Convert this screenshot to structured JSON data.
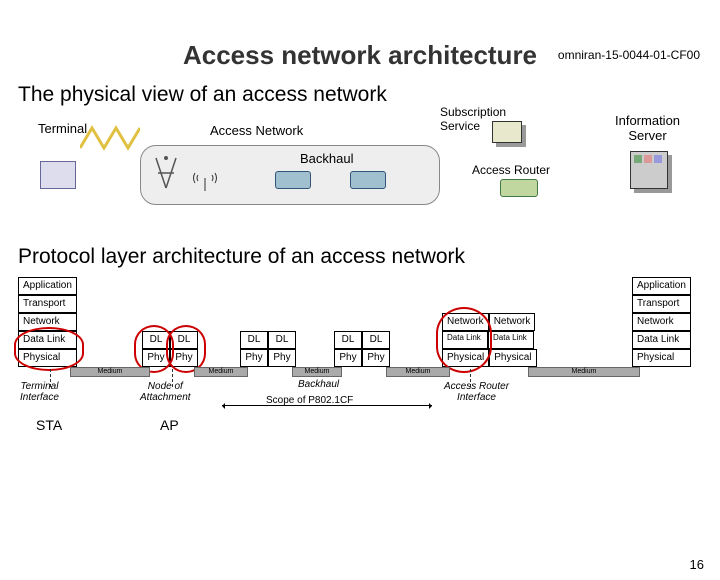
{
  "doc_id": "omniran-15-0044-01-CF00",
  "title": "Access network architecture",
  "subtitle1": "The physical view of an access network",
  "subtitle2": "Protocol layer architecture of an access network",
  "phys": {
    "terminal": "Terminal",
    "access_network": "Access Network",
    "backhaul": "Backhaul",
    "subscription_service": "Subscription\nService",
    "access_router": "Access Router",
    "information_server": "Information\nServer"
  },
  "proto": {
    "layers_left": [
      "Application",
      "Transport",
      "Network",
      "Data Link",
      "Physical"
    ],
    "layers_right": [
      "Application",
      "Transport",
      "Network",
      "Data Link",
      "Physical"
    ],
    "mid_top": [
      "Network",
      "Network"
    ],
    "mid_dl": [
      "Data Link",
      "Data Link"
    ],
    "mid_phy": [
      "Physical",
      "Physical"
    ],
    "dl": "DL",
    "phy": "Phy",
    "medium": "Medium",
    "terminal_if": "Terminal\nInterface",
    "node_of_attachment": "Node of\nAttachment",
    "backhaul": "Backhaul",
    "ar_if": "Access Router\nInterface",
    "sta": "STA",
    "ap": "AP",
    "scope": "Scope of P802.1CF"
  },
  "page_number": "16"
}
